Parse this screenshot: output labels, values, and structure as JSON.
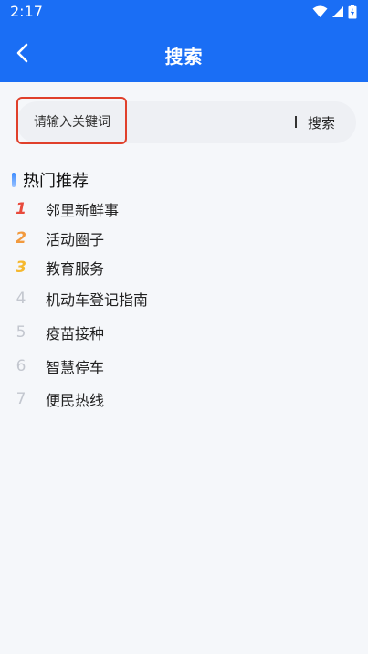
{
  "status_bar": {
    "time": "2:17",
    "icons": [
      "wifi-icon",
      "signal-icon",
      "battery-icon"
    ]
  },
  "header": {
    "title": "搜索",
    "back_icon": "chevron-left-icon"
  },
  "search": {
    "placeholder": "请输入关键词",
    "button_label": "搜索"
  },
  "hot": {
    "section_title": "热门推荐",
    "items": [
      {
        "rank": "1",
        "label": "邻里新鲜事"
      },
      {
        "rank": "2",
        "label": "活动圈子"
      },
      {
        "rank": "3",
        "label": "教育服务"
      },
      {
        "rank": "4",
        "label": "机动车登记指南"
      },
      {
        "rank": "5",
        "label": "疫苗接种"
      },
      {
        "rank": "6",
        "label": "智慧停车"
      },
      {
        "rank": "7",
        "label": "便民热线"
      }
    ]
  },
  "colors": {
    "header_bg": "#1a6ef5",
    "page_bg": "#f5f7fa",
    "rank_1": "#e84a3c",
    "rank_2": "#f29a3d",
    "rank_3": "#f5b82e",
    "rank_other": "#c3c7cf",
    "highlight_border": "#e0402b"
  }
}
